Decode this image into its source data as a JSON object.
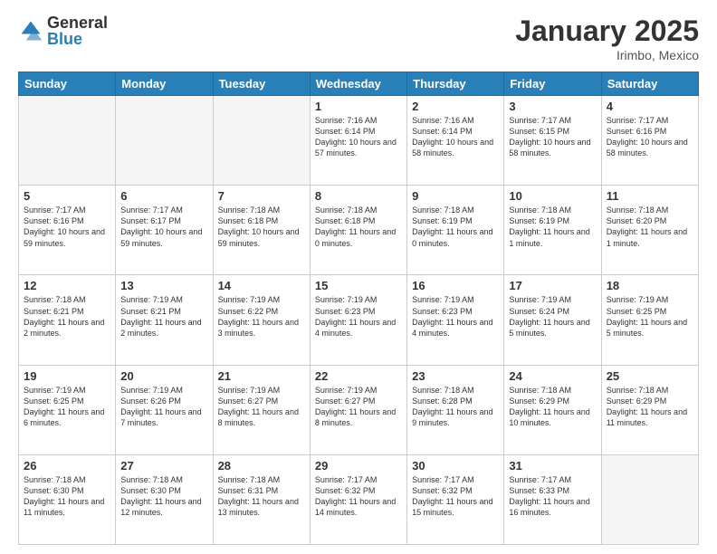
{
  "header": {
    "logo_general": "General",
    "logo_blue": "Blue",
    "month_year": "January 2025",
    "location": "Irimbo, Mexico"
  },
  "days_of_week": [
    "Sunday",
    "Monday",
    "Tuesday",
    "Wednesday",
    "Thursday",
    "Friday",
    "Saturday"
  ],
  "weeks": [
    [
      {
        "day": "",
        "empty": true
      },
      {
        "day": "",
        "empty": true
      },
      {
        "day": "",
        "empty": true
      },
      {
        "day": "1",
        "info": "Sunrise: 7:16 AM\nSunset: 6:14 PM\nDaylight: 10 hours and 57 minutes."
      },
      {
        "day": "2",
        "info": "Sunrise: 7:16 AM\nSunset: 6:14 PM\nDaylight: 10 hours and 58 minutes."
      },
      {
        "day": "3",
        "info": "Sunrise: 7:17 AM\nSunset: 6:15 PM\nDaylight: 10 hours and 58 minutes."
      },
      {
        "day": "4",
        "info": "Sunrise: 7:17 AM\nSunset: 6:16 PM\nDaylight: 10 hours and 58 minutes."
      }
    ],
    [
      {
        "day": "5",
        "info": "Sunrise: 7:17 AM\nSunset: 6:16 PM\nDaylight: 10 hours and 59 minutes."
      },
      {
        "day": "6",
        "info": "Sunrise: 7:17 AM\nSunset: 6:17 PM\nDaylight: 10 hours and 59 minutes."
      },
      {
        "day": "7",
        "info": "Sunrise: 7:18 AM\nSunset: 6:18 PM\nDaylight: 10 hours and 59 minutes."
      },
      {
        "day": "8",
        "info": "Sunrise: 7:18 AM\nSunset: 6:18 PM\nDaylight: 11 hours and 0 minutes."
      },
      {
        "day": "9",
        "info": "Sunrise: 7:18 AM\nSunset: 6:19 PM\nDaylight: 11 hours and 0 minutes."
      },
      {
        "day": "10",
        "info": "Sunrise: 7:18 AM\nSunset: 6:19 PM\nDaylight: 11 hours and 1 minute."
      },
      {
        "day": "11",
        "info": "Sunrise: 7:18 AM\nSunset: 6:20 PM\nDaylight: 11 hours and 1 minute."
      }
    ],
    [
      {
        "day": "12",
        "info": "Sunrise: 7:18 AM\nSunset: 6:21 PM\nDaylight: 11 hours and 2 minutes."
      },
      {
        "day": "13",
        "info": "Sunrise: 7:19 AM\nSunset: 6:21 PM\nDaylight: 11 hours and 2 minutes."
      },
      {
        "day": "14",
        "info": "Sunrise: 7:19 AM\nSunset: 6:22 PM\nDaylight: 11 hours and 3 minutes."
      },
      {
        "day": "15",
        "info": "Sunrise: 7:19 AM\nSunset: 6:23 PM\nDaylight: 11 hours and 4 minutes."
      },
      {
        "day": "16",
        "info": "Sunrise: 7:19 AM\nSunset: 6:23 PM\nDaylight: 11 hours and 4 minutes."
      },
      {
        "day": "17",
        "info": "Sunrise: 7:19 AM\nSunset: 6:24 PM\nDaylight: 11 hours and 5 minutes."
      },
      {
        "day": "18",
        "info": "Sunrise: 7:19 AM\nSunset: 6:25 PM\nDaylight: 11 hours and 5 minutes."
      }
    ],
    [
      {
        "day": "19",
        "info": "Sunrise: 7:19 AM\nSunset: 6:25 PM\nDaylight: 11 hours and 6 minutes."
      },
      {
        "day": "20",
        "info": "Sunrise: 7:19 AM\nSunset: 6:26 PM\nDaylight: 11 hours and 7 minutes."
      },
      {
        "day": "21",
        "info": "Sunrise: 7:19 AM\nSunset: 6:27 PM\nDaylight: 11 hours and 8 minutes."
      },
      {
        "day": "22",
        "info": "Sunrise: 7:19 AM\nSunset: 6:27 PM\nDaylight: 11 hours and 8 minutes."
      },
      {
        "day": "23",
        "info": "Sunrise: 7:18 AM\nSunset: 6:28 PM\nDaylight: 11 hours and 9 minutes."
      },
      {
        "day": "24",
        "info": "Sunrise: 7:18 AM\nSunset: 6:29 PM\nDaylight: 11 hours and 10 minutes."
      },
      {
        "day": "25",
        "info": "Sunrise: 7:18 AM\nSunset: 6:29 PM\nDaylight: 11 hours and 11 minutes."
      }
    ],
    [
      {
        "day": "26",
        "info": "Sunrise: 7:18 AM\nSunset: 6:30 PM\nDaylight: 11 hours and 11 minutes."
      },
      {
        "day": "27",
        "info": "Sunrise: 7:18 AM\nSunset: 6:30 PM\nDaylight: 11 hours and 12 minutes."
      },
      {
        "day": "28",
        "info": "Sunrise: 7:18 AM\nSunset: 6:31 PM\nDaylight: 11 hours and 13 minutes."
      },
      {
        "day": "29",
        "info": "Sunrise: 7:17 AM\nSunset: 6:32 PM\nDaylight: 11 hours and 14 minutes."
      },
      {
        "day": "30",
        "info": "Sunrise: 7:17 AM\nSunset: 6:32 PM\nDaylight: 11 hours and 15 minutes."
      },
      {
        "day": "31",
        "info": "Sunrise: 7:17 AM\nSunset: 6:33 PM\nDaylight: 11 hours and 16 minutes."
      },
      {
        "day": "",
        "empty": true
      }
    ]
  ]
}
